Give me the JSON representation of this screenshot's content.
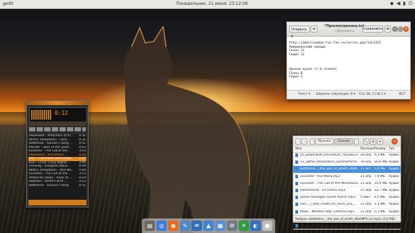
{
  "topbar": {
    "app": "gedit",
    "clock": "Понедельник, 21 июня, 23:12:08",
    "tray_icons": [
      "network-icon",
      "volume-icon",
      "battery-icon",
      "power-icon"
    ]
  },
  "gedit": {
    "open_label": "Открыть ▾",
    "new_tab": "+",
    "title": "*Просмотренное.txt",
    "path": "~/Документы",
    "save_label": "Сохранить",
    "menu": "≡",
    "min": "–",
    "max": "□",
    "close": "×",
    "lines": [
      "",
      "http://americandad.fox-fan.ru/series.php?id=1222",
      "Американский папаша",
      "Сезон 11",
      "Серия 12",
      "",
      "",
      "",
      "Адская кухня (с 6 сезона)",
      "Сезон 6",
      "Серия 1"
    ],
    "status": {
      "mode": "Текст ▾",
      "tab_width": "Ширина табуляции: 8 ▾",
      "position": "Стр 38, Стлб 1 ▾",
      "insert": "ВСТ"
    }
  },
  "audacious": {
    "time": "0:12",
    "playlist": [
      {
        "title": "Powerwolf - Preachers of th...",
        "time": "4:32",
        "state": "normal"
      },
      {
        "title": "Within Temptation - Faith...",
        "time": "4:31",
        "state": "normal"
      },
      {
        "title": "Battlelore - Sauron's Song ...",
        "time": "4:51",
        "state": "normal"
      },
      {
        "title": "Myrath - Tales of the Sand...",
        "time": "4:02",
        "state": "normal"
      },
      {
        "title": "Eluveitie - The Call of the...",
        "time": "3:53",
        "state": "normal"
      },
      {
        "title": "Powerwolf - Kreuzfeuer ...",
        "time": "4:16",
        "state": "alt"
      },
      {
        "title": "OST - Command and Conqu...",
        "time": "2:47",
        "state": "current"
      },
      {
        "title": "Kiss - Crazy Crazy Nights ...",
        "time": "3:46",
        "state": "normal"
      },
      {
        "title": "Unheilig - Zeitgeist Delux...",
        "time": "4:49",
        "state": "normal"
      },
      {
        "title": "Within Temptation - And We...",
        "time": "5:04",
        "state": "normal"
      },
      {
        "title": "Eluveitie - The Call of the...",
        "time": "3:53",
        "state": "normal"
      },
      {
        "title": "Amberian Dawn - River of ...",
        "time": "4:10",
        "state": "normal"
      },
      {
        "title": "Sabaton - Rorke's Drift ...",
        "time": "3:23",
        "state": "normal"
      },
      {
        "title": "Battlelore - Sauron's Song",
        "time": "4:51",
        "state": "normal"
      }
    ]
  },
  "nautilus": {
    "back": "‹",
    "forward": "›",
    "crumbs": [
      "‹",
      "Музыка",
      "Сонник",
      "›"
    ],
    "search_icon": "🔍",
    "view_icon": "☰",
    "menu_icon": "≡",
    "close_icon": "×",
    "columns": {
      "name": "Имя",
      "modified": "Последн",
      "size": "Размер",
      "type": "Тип"
    },
    "files": [
      {
        "name": "05_powerwolf_kreuzfeuer_mysuka.o...",
        "modified": "29 апр",
        "size": "9,3 МБ",
        "type": "Аудио",
        "selected": false
      },
      {
        "name": "12_within_temptation_summertime...",
        "modified": "19 апр",
        "size": "10,6 МБ",
        "type": "Аудио",
        "selected": false
      },
      {
        "name": "battlelore_-_the_war_of_wrath_(Nati...",
        "modified": "21 окт",
        "size": "5,6 МБ",
        "type": "Аудио",
        "selected": true
      },
      {
        "name": "Eluveitie - Inis Mona.mp3",
        "modified": "21 апр",
        "size": "7,9 МБ",
        "type": "Аудио",
        "selected": false
      },
      {
        "name": "Eluveitie - The Call of the Mountains...",
        "modified": "21 апр",
        "size": "10,9 МБ",
        "type": "Аудио",
        "selected": false
      },
      {
        "name": "HammerFall - Ex Inferis.mp3",
        "modified": "21 апр",
        "size": "12,7 МБ",
        "type": "Аудио",
        "selected": false
      },
      {
        "name": "james hannigan soviet march.mp3",
        "modified": "5 июн",
        "size": "4,5 МБ",
        "type": "Аудио",
        "selected": false
      },
      {
        "name": "kiss_-_i_was_made_for_lovin_you_...",
        "modified": "21 апр",
        "size": "1,3 МБ",
        "type": "Аудио",
        "selected": false
      },
      {
        "name": "Muse - Neutron Star Collision.mp3",
        "modified": "21 апр",
        "size": "5,3 МБ",
        "type": "Аудио",
        "selected": false
      },
      {
        "name": "Unheilig 2015 - Zirkus Zeitgeist (Del...",
        "modified": "21 окт",
        "size": "6,7 МБ",
        "type": "Аудио",
        "selected": false
      },
      {
        "name": "Within Temptation - And We Run.mp3",
        "modified": "21 апр",
        "size": "9,5 МБ",
        "type": "Аудио",
        "selected": false
      }
    ],
    "status": "Выбран «battlelore_-_the_war_of_wrath_(NatiMP3.ru).mp3» (5,6 МБ)"
  },
  "dock": [
    {
      "name": "files-icon",
      "glyph": "▤",
      "color": "#6f6a63"
    },
    {
      "name": "chromium-icon",
      "glyph": "◎",
      "color": "#3b7dd8"
    },
    {
      "name": "firefox-icon",
      "glyph": "◉",
      "color": "#e66a1e"
    },
    {
      "name": "gedit-icon",
      "glyph": "✎",
      "color": "#4f86c6"
    },
    {
      "name": "thunderbird-icon",
      "glyph": "✉",
      "color": "#2f6fb8"
    },
    {
      "name": "folder-icon",
      "glyph": "▲",
      "color": "#3f86d3"
    },
    {
      "name": "writer-icon",
      "glyph": "▦",
      "color": "#5a8ed0"
    },
    {
      "name": "settings-icon",
      "glyph": "⚙",
      "color": "#6f7a86"
    },
    {
      "name": "spreadsheet-icon",
      "glyph": "✕",
      "color": "#2f9a42"
    },
    {
      "name": "audacious-icon",
      "glyph": "◐",
      "color": "#2d6fc1"
    },
    {
      "name": "trash-icon",
      "glyph": "●",
      "color": "#bdbdbd"
    }
  ]
}
